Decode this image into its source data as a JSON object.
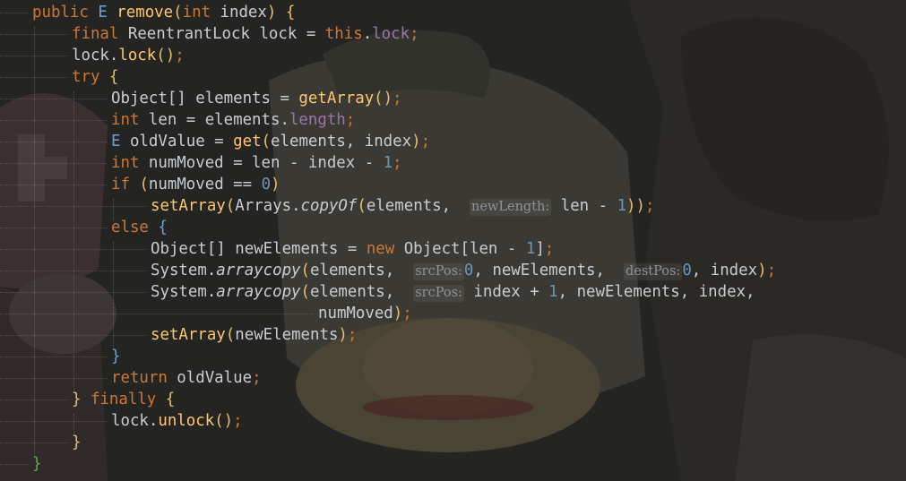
{
  "code": {
    "l1": {
      "kw_public": "public",
      "type_e": "E",
      "fn_remove": "remove",
      "lp": "(",
      "kw_int": "int",
      "param_index": "index",
      "rp": ")",
      "lb": "{"
    },
    "l2": {
      "kw_final": "final",
      "type_lock": "ReentrantLock",
      "var_lock": "lock",
      "eq": "=",
      "kw_this": "this",
      "dot": ".",
      "field_lock": "lock",
      "semi": ";"
    },
    "l3": {
      "text_a": "lock.",
      "fn_lock": "lock",
      "paren": "()",
      "semi": ";"
    },
    "l4": {
      "kw_try": "try",
      "lb": "{"
    },
    "l5": {
      "text_a": "Object[] elements = ",
      "fn": "getArray",
      "paren": "()",
      "semi": ";"
    },
    "l6": {
      "kw_int": "int",
      "text_a": " len = elements.",
      "field": "length",
      "semi": ";"
    },
    "l7": {
      "type_e": "E",
      "text_a": " oldValue = ",
      "fn": "get",
      "lp": "(",
      "text_b": "elements, index",
      "rp": ")",
      "semi": ";"
    },
    "l8": {
      "kw_int": "int",
      "text_a": " numMoved = len - index - ",
      "num": "1",
      "semi": ";"
    },
    "l9": {
      "kw_if": "if",
      "lp": "(",
      "text_a": "numMoved == ",
      "num": "0",
      "rp": ")"
    },
    "l10": {
      "fn": "setArray",
      "lp": "(",
      "text_a": "Arrays.",
      "fn_italic": "copyOf",
      "lp2": "(",
      "text_b": "elements, ",
      "hint": "newLength:",
      "text_c": " len - ",
      "num": "1",
      "rp": "))",
      "semi": ";"
    },
    "l11": {
      "kw_else": "else",
      "lb": "{"
    },
    "l12": {
      "text_a": "Object[] newElements = ",
      "kw_new": "new",
      "text_b": " Object[len - ",
      "num": "1",
      "text_c": "]",
      "semi": ";"
    },
    "l13": {
      "text_a": "System.",
      "fn_italic": "arraycopy",
      "lp": "(",
      "text_b": "elements, ",
      "hint1": "srcPos:",
      "num1": "0",
      "text_c": ", newElements, ",
      "hint2": "destPos:",
      "num2": "0",
      "text_d": ", index",
      "rp": ")",
      "semi": ";"
    },
    "l14": {
      "text_a": "System.",
      "fn_italic": "arraycopy",
      "lp": "(",
      "text_b": "elements, ",
      "hint1": "srcPos:",
      "text_c": " index + ",
      "num": "1",
      "text_d": ", newElements, index,"
    },
    "l15": {
      "text_a": "numMoved",
      "rp": ")",
      "semi": ";"
    },
    "l16": {
      "fn": "setArray",
      "lp": "(",
      "text_a": "newElements",
      "rp": ")",
      "semi": ";"
    },
    "l17": {
      "rb": "}"
    },
    "l18": {
      "kw_return": "return",
      "text_a": " oldValue",
      "semi": ";"
    },
    "l19": {
      "rb": "}",
      "kw_finally": "finally",
      "lb": "{"
    },
    "l20": {
      "text_a": "lock.",
      "fn": "unlock",
      "paren": "()",
      "semi": ";"
    },
    "l21": {
      "rb": "}"
    },
    "l22": {
      "rb": "}"
    }
  },
  "colors": {
    "keyword": "#cc7832",
    "type_param": "#6aa0d6",
    "method": "#ffc66d",
    "field": "#9876aa",
    "number": "#6897bb",
    "text": "#c9cdd1",
    "background": "#2b2b2b"
  },
  "background_image": "one-piece-anime-wallpaper"
}
